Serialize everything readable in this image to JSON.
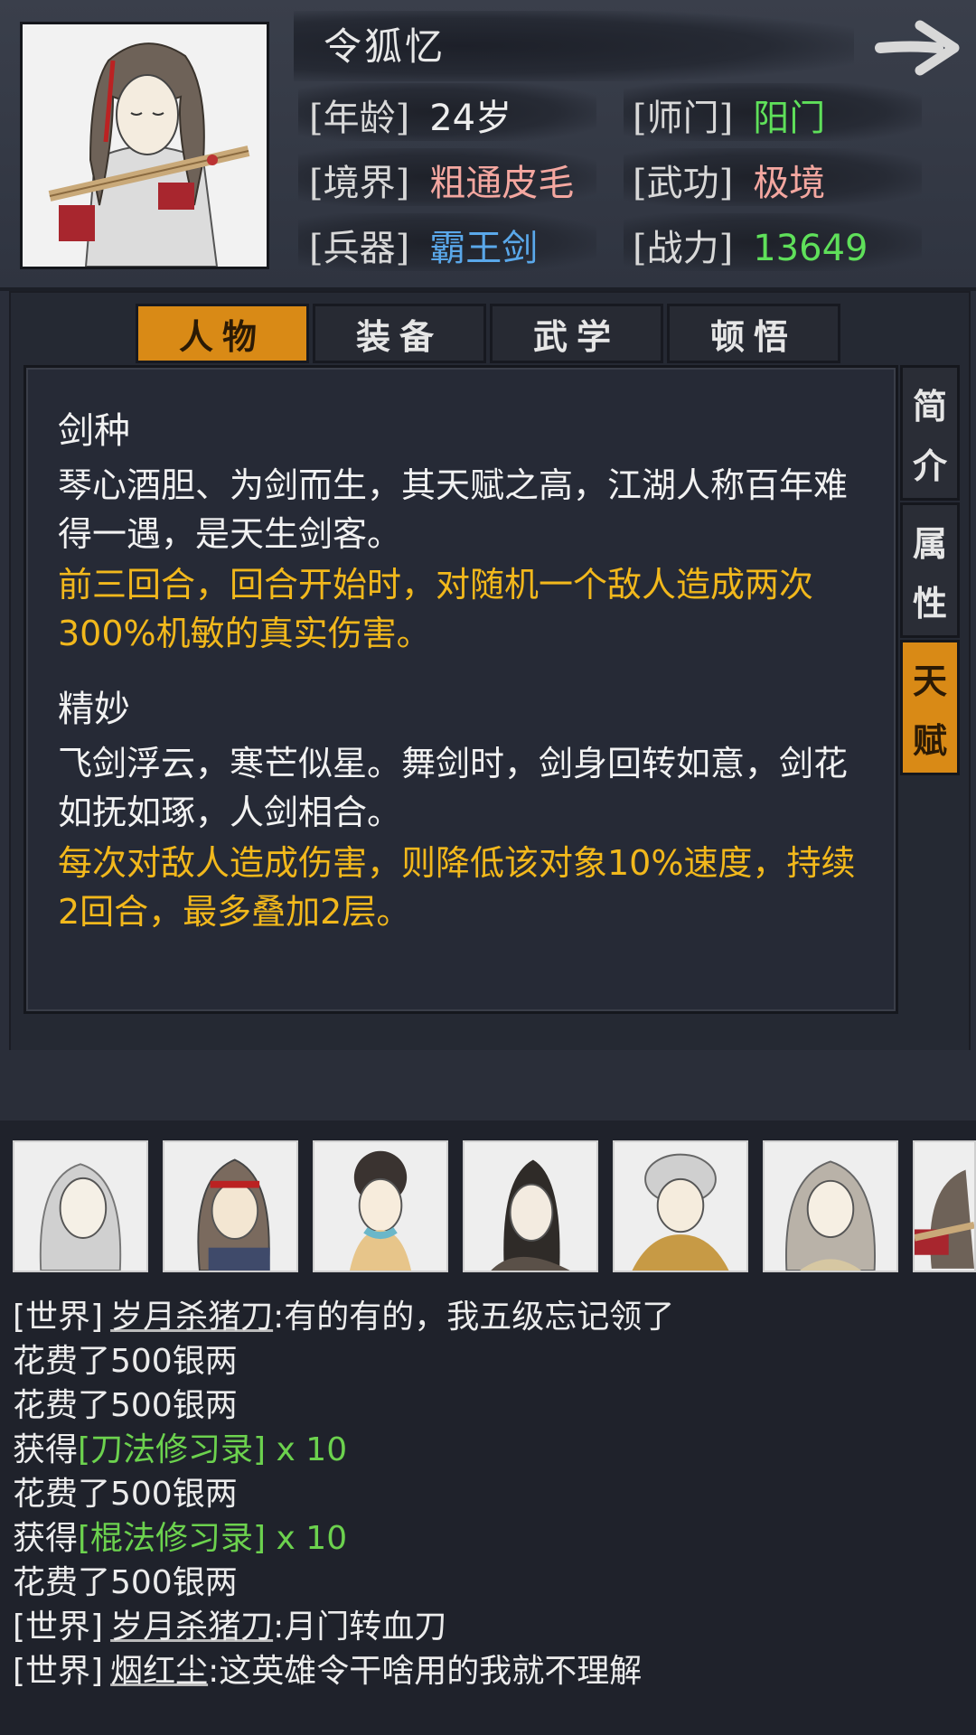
{
  "character": {
    "name": "令狐忆",
    "stats": [
      {
        "label": "[年龄]",
        "value": "24岁",
        "color": "#eeeeee"
      },
      {
        "label": "[师门]",
        "value": "阳门",
        "color": "#5fe05a"
      },
      {
        "label": "[境界]",
        "value": "粗通皮毛",
        "color": "#f4a7a0"
      },
      {
        "label": "[武功]",
        "value": "极境",
        "color": "#f4a7a0"
      },
      {
        "label": "[兵器]",
        "value": "霸王剑",
        "color": "#5aa8ea"
      },
      {
        "label": "[战力]",
        "value": "13649",
        "color": "#5fe05a"
      }
    ]
  },
  "tabs": [
    {
      "label": "人物",
      "active": true
    },
    {
      "label": "装备",
      "active": false
    },
    {
      "label": "武学",
      "active": false
    },
    {
      "label": "顿悟",
      "active": false
    }
  ],
  "side_tabs": [
    {
      "chars": [
        "简",
        "介"
      ],
      "active": false
    },
    {
      "chars": [
        "属",
        "性"
      ],
      "active": false
    },
    {
      "chars": [
        "天",
        "赋"
      ],
      "active": true
    }
  ],
  "talents": [
    {
      "name": "剑种",
      "desc": "琴心酒胆、为剑而生，其天赋之高，江湖人称百年难得一遇，是天生剑客。",
      "effect": "前三回合，回合开始时，对随机一个敌人造成两次300%机敏的真实伤害。"
    },
    {
      "name": "精妙",
      "desc": "飞剑浮云，寒芒似星。舞剑时，剑身回转如意，剑花如抚如琢，人剑相合。",
      "effect": "每次对敌人造成伤害，则降低该对象10%速度，持续2回合，最多叠加2层。"
    }
  ],
  "chat": [
    {
      "channel": "[世界]",
      "user": "岁月杀猪刀",
      "text": ":有的有的，我五级忘记领了"
    },
    {
      "text": "花费了500银两"
    },
    {
      "text": "花费了500银两"
    },
    {
      "prefix": "获得",
      "item": "[刀法修习录]",
      "suffix": " x 10"
    },
    {
      "text": "花费了500银两"
    },
    {
      "prefix": "获得",
      "item": "[棍法修习录]",
      "suffix": " x 10"
    },
    {
      "text": "花费了500银两"
    },
    {
      "channel": "[世界]",
      "user": "岁月杀猪刀",
      "text": ":月门转血刀"
    },
    {
      "channel": "[世界]",
      "user": "烟红尘",
      "text": ":这英雄令干啥用的我就不理解"
    }
  ],
  "colors": {
    "accent": "#d98a16",
    "effect_text": "#f2b81c",
    "item_text": "#6cd24e"
  }
}
